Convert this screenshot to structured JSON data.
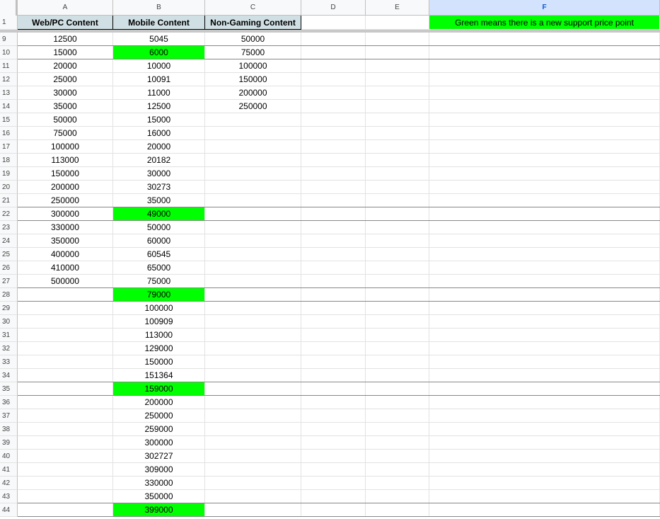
{
  "columns": [
    {
      "letter": "A",
      "selected": false
    },
    {
      "letter": "B",
      "selected": false
    },
    {
      "letter": "C",
      "selected": false
    },
    {
      "letter": "D",
      "selected": false
    },
    {
      "letter": "E",
      "selected": false
    },
    {
      "letter": "F",
      "selected": true
    }
  ],
  "header_row": {
    "number": "1",
    "A": "Web/PC Content",
    "B": "Mobile Content",
    "C": "Non-Gaming Content",
    "F": "Green means there is a new support price point"
  },
  "highlight_color": "#00ff00",
  "rows": [
    {
      "num": "9",
      "A": "12500",
      "B": "5045",
      "C": "50000",
      "green": false
    },
    {
      "num": "10",
      "A": "15000",
      "B": "6000",
      "C": "75000",
      "green": true
    },
    {
      "num": "11",
      "A": "20000",
      "B": "10000",
      "C": "100000",
      "green": false
    },
    {
      "num": "12",
      "A": "25000",
      "B": "10091",
      "C": "150000",
      "green": false
    },
    {
      "num": "13",
      "A": "30000",
      "B": "11000",
      "C": "200000",
      "green": false
    },
    {
      "num": "14",
      "A": "35000",
      "B": "12500",
      "C": "250000",
      "green": false
    },
    {
      "num": "15",
      "A": "50000",
      "B": "15000",
      "C": "",
      "green": false
    },
    {
      "num": "16",
      "A": "75000",
      "B": "16000",
      "C": "",
      "green": false
    },
    {
      "num": "17",
      "A": "100000",
      "B": "20000",
      "C": "",
      "green": false
    },
    {
      "num": "18",
      "A": "113000",
      "B": "20182",
      "C": "",
      "green": false
    },
    {
      "num": "19",
      "A": "150000",
      "B": "30000",
      "C": "",
      "green": false
    },
    {
      "num": "20",
      "A": "200000",
      "B": "30273",
      "C": "",
      "green": false
    },
    {
      "num": "21",
      "A": "250000",
      "B": "35000",
      "C": "",
      "green": false
    },
    {
      "num": "22",
      "A": "300000",
      "B": "49000",
      "C": "",
      "green": true
    },
    {
      "num": "23",
      "A": "330000",
      "B": "50000",
      "C": "",
      "green": false
    },
    {
      "num": "24",
      "A": "350000",
      "B": "60000",
      "C": "",
      "green": false
    },
    {
      "num": "25",
      "A": "400000",
      "B": "60545",
      "C": "",
      "green": false
    },
    {
      "num": "26",
      "A": "410000",
      "B": "65000",
      "C": "",
      "green": false
    },
    {
      "num": "27",
      "A": "500000",
      "B": "75000",
      "C": "",
      "green": false
    },
    {
      "num": "28",
      "A": "",
      "B": "79000",
      "C": "",
      "green": true
    },
    {
      "num": "29",
      "A": "",
      "B": "100000",
      "C": "",
      "green": false
    },
    {
      "num": "30",
      "A": "",
      "B": "100909",
      "C": "",
      "green": false
    },
    {
      "num": "31",
      "A": "",
      "B": "113000",
      "C": "",
      "green": false
    },
    {
      "num": "32",
      "A": "",
      "B": "129000",
      "C": "",
      "green": false
    },
    {
      "num": "33",
      "A": "",
      "B": "150000",
      "C": "",
      "green": false
    },
    {
      "num": "34",
      "A": "",
      "B": "151364",
      "C": "",
      "green": false
    },
    {
      "num": "35",
      "A": "",
      "B": "159000",
      "C": "",
      "green": true
    },
    {
      "num": "36",
      "A": "",
      "B": "200000",
      "C": "",
      "green": false
    },
    {
      "num": "37",
      "A": "",
      "B": "250000",
      "C": "",
      "green": false
    },
    {
      "num": "38",
      "A": "",
      "B": "259000",
      "C": "",
      "green": false
    },
    {
      "num": "39",
      "A": "",
      "B": "300000",
      "C": "",
      "green": false
    },
    {
      "num": "40",
      "A": "",
      "B": "302727",
      "C": "",
      "green": false
    },
    {
      "num": "41",
      "A": "",
      "B": "309000",
      "C": "",
      "green": false
    },
    {
      "num": "42",
      "A": "",
      "B": "330000",
      "C": "",
      "green": false
    },
    {
      "num": "43",
      "A": "",
      "B": "350000",
      "C": "",
      "green": false
    },
    {
      "num": "44",
      "A": "",
      "B": "399000",
      "C": "",
      "green": true
    }
  ]
}
